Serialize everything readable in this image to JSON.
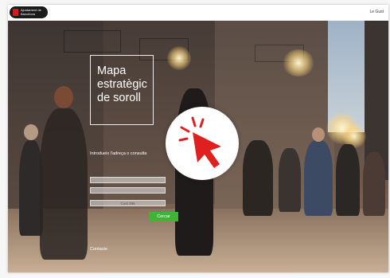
{
  "header": {
    "logo_text_line1": "Ajuntament de",
    "logo_text_line2": "Barcelona",
    "language": "Le Gust"
  },
  "hero": {
    "title_line1": "Mapa",
    "title_line2": "estratègic",
    "title_line3": "de soroll"
  },
  "search": {
    "label": "Introdueix l'adreça o consulta",
    "field3_text": "Cust 288",
    "button_label": "Cercar"
  },
  "footer": {
    "contact_label": "Contacte"
  },
  "colors": {
    "brand_red": "#d7181f",
    "search_green": "#3fb535"
  },
  "icons": {
    "cursor": "click-cursor-icon"
  }
}
